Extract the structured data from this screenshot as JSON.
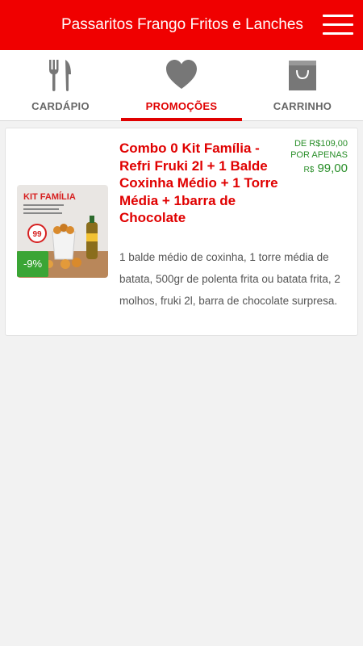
{
  "header": {
    "title": "Passaritos Frango Fritos e Lanches",
    "menu_icon": "hamburger-menu-icon",
    "background": "#f00000"
  },
  "tabs": [
    {
      "label": "CARDÁPIO",
      "icon": "fork-knife-icon",
      "active": false
    },
    {
      "label": "PROMOÇÕES",
      "icon": "heart-icon",
      "active": true
    },
    {
      "label": "CARRINHO",
      "icon": "shopping-bag-icon",
      "active": false
    }
  ],
  "promo": {
    "title": "Combo 0 Kit Família - Refri Fruki 2l + 1 Balde Coxinha Médio + 1 Torre Média + 1barra de Chocolate",
    "price_old": "DE R$109,00",
    "price_label": "POR APENAS",
    "price_currency": "R$",
    "price_new": "99,00",
    "discount": "-9%",
    "description": "1 balde médio de coxinha, 1 torre média de batata, 500gr de polenta frita ou batata frita, 2 molhos, fruki 2l, barra de chocolate surpresa.",
    "image_label": "KIT FAMÍLIA",
    "image_price": "99"
  },
  "colors": {
    "accent": "#e00000",
    "price": "#2a8f2a",
    "discount": "#3aa535",
    "tab_inactive": "#666666"
  }
}
